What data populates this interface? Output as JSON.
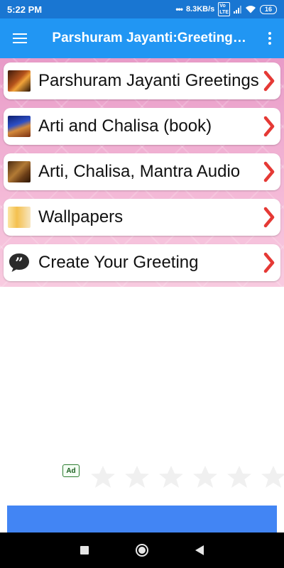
{
  "status_bar": {
    "time": "5:22 PM",
    "network_speed": "8.3KB/s",
    "network_tag": "VoLTE",
    "battery": "16",
    "icons": [
      "signal-icon",
      "wifi-icon",
      "battery-icon"
    ]
  },
  "app_bar": {
    "title": "Parshuram Jayanti:Greeting…",
    "menu_icon": "hamburger-icon",
    "overflow_icon": "more-vert-icon"
  },
  "menu": {
    "items": [
      {
        "label": "Parshuram Jayanti Greetings",
        "icon": "greetings-thumbnail"
      },
      {
        "label": "Arti and Chalisa (book)",
        "icon": "book-thumbnail"
      },
      {
        "label": "Arti, Chalisa, Mantra Audio",
        "icon": "audio-thumbnail"
      },
      {
        "label": "Wallpapers",
        "icon": "wallpaper-thumbnail"
      },
      {
        "label": "Create Your Greeting",
        "icon": "quote-bubble-icon"
      }
    ],
    "chevron_icon": "chevron-right-icon"
  },
  "ad": {
    "badge": "Ad",
    "star_icon": "star-icon"
  },
  "colors": {
    "status_bar": "#1976d2",
    "app_bar": "#2196f3",
    "chevron": "#e53935",
    "ad_banner": "#4285f4",
    "menu_background": "#f3b7d6"
  }
}
